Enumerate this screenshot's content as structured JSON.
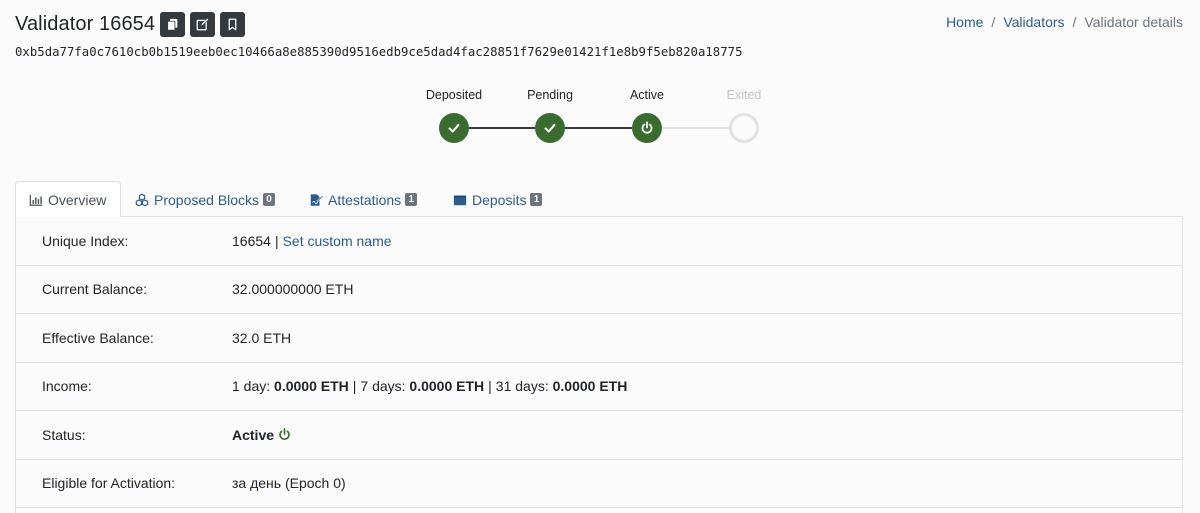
{
  "header": {
    "title": "Validator 16654",
    "pubkey": "0xb5da77fa0c7610cb0b1519eeb0ec10466a8e885390d9516edb9ce5dad4fac28851f7629e01421f1e8b9f5eb820a18775"
  },
  "breadcrumb": {
    "home": "Home",
    "validators": "Validators",
    "current": "Validator details",
    "separator": "/"
  },
  "stepper": {
    "steps": [
      {
        "label": "Deposited",
        "state": "done"
      },
      {
        "label": "Pending",
        "state": "done"
      },
      {
        "label": "Active",
        "state": "active"
      },
      {
        "label": "Exited",
        "state": "inactive"
      }
    ],
    "color_done": "#3a6b2f"
  },
  "tabs": [
    {
      "label": "Overview",
      "icon": "chart-icon",
      "badge": ""
    },
    {
      "label": "Proposed Blocks",
      "icon": "cubes-icon",
      "badge": "0"
    },
    {
      "label": "Attestations",
      "icon": "signature-icon",
      "badge": "1"
    },
    {
      "label": "Deposits",
      "icon": "wallet-icon",
      "badge": "1"
    }
  ],
  "details": {
    "unique_index": {
      "label": "Unique Index:",
      "value": "16654",
      "link": "Set custom name"
    },
    "current_balance": {
      "label": "Current Balance:",
      "value": "32.000000000 ETH"
    },
    "effective_balance": {
      "label": "Effective Balance:",
      "value": "32.0 ETH"
    },
    "income": {
      "label": "Income:",
      "d1_label": "1 day:",
      "d1_value": "0.0000 ETH",
      "d7_label": "7 days:",
      "d7_value": "0.0000 ETH",
      "d31_label": "31 days:",
      "d31_value": "0.0000 ETH"
    },
    "status": {
      "label": "Status:",
      "value": "Active"
    },
    "eligible": {
      "label": "Eligible for Activation:",
      "value": "за день (Epoch 0)"
    }
  },
  "colors": {
    "link": "#2a5d8f",
    "active_green": "#3a6b2f",
    "dark_button": "#343a40"
  }
}
